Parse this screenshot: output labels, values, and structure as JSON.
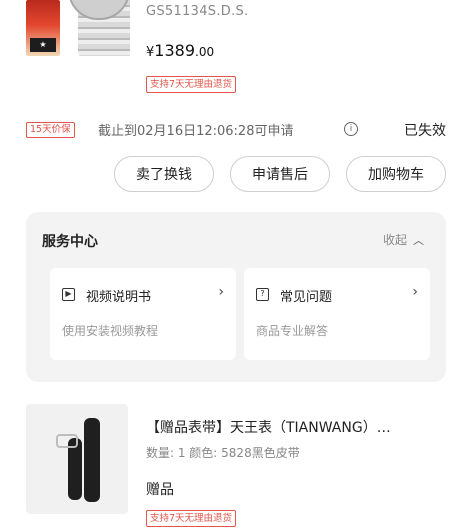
{
  "product_main": {
    "subtitle": "GS51134S.D.S.",
    "price_currency": "¥",
    "price_int": "1389",
    "price_dec": ".00",
    "return_badge": "支持7天无理由退货"
  },
  "price_protect": {
    "badge": "15天价保",
    "text": "截止到02月16日12:06:28可申请",
    "info_icon": "ⓘ",
    "status": "已失效"
  },
  "actions": {
    "sell": "卖了换钱",
    "after_sales": "申请售后",
    "add_cart": "加购物车"
  },
  "service_center": {
    "title": "服务中心",
    "collapse": "收起",
    "items": [
      {
        "icon": "play-icon",
        "label": "视频说明书",
        "desc": "使用安装视频教程"
      },
      {
        "icon": "question-icon",
        "label": "常见问题",
        "desc": "商品专业解答"
      }
    ]
  },
  "product_gift": {
    "title": "【赠品表带】天王表（TIANWANG）…",
    "spec": "数量: 1  颜色: 5828黑色皮带",
    "tag": "赠品",
    "return_badge": "支持7天无理由退货"
  },
  "colors": {
    "accent_red": "#e4544a",
    "text_primary": "#222222",
    "text_secondary": "#888888"
  }
}
